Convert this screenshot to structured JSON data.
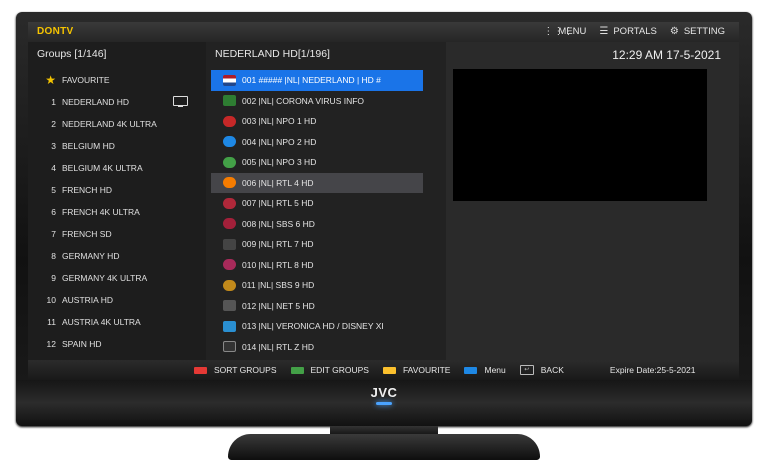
{
  "tv": {
    "brand": "JVC"
  },
  "app": {
    "logo": "DONTV"
  },
  "topmenu": {
    "menu": {
      "icon": "grid-icon",
      "label": "MENU"
    },
    "portals": {
      "icon": "portals-icon",
      "label": "PORTALS"
    },
    "setting": {
      "icon": "gear-icon",
      "label": "SETTING"
    }
  },
  "groups": {
    "title": "Groups [1/146]",
    "items": [
      {
        "num": "",
        "label": "FAVOURITE"
      },
      {
        "num": "1",
        "label": "NEDERLAND HD"
      },
      {
        "num": "2",
        "label": "NEDERLAND 4K ULTRA"
      },
      {
        "num": "3",
        "label": "BELGIUM HD"
      },
      {
        "num": "4",
        "label": "BELGIUM 4K ULTRA"
      },
      {
        "num": "5",
        "label": "FRENCH HD"
      },
      {
        "num": "6",
        "label": "FRENCH 4K ULTRA"
      },
      {
        "num": "7",
        "label": "FRENCH SD"
      },
      {
        "num": "8",
        "label": "GERMANY HD"
      },
      {
        "num": "9",
        "label": "GERMANY 4K ULTRA"
      },
      {
        "num": "10",
        "label": "AUSTRIA HD"
      },
      {
        "num": "11",
        "label": "AUSTRIA 4K ULTRA"
      },
      {
        "num": "12",
        "label": "SPAIN HD"
      }
    ]
  },
  "channels": {
    "title": "NEDERLAND HD[1/196]",
    "items": [
      {
        "text": "001  ##### |NL| NEDERLAND | HD #",
        "color": "#ae1c28",
        "logo": ""
      },
      {
        "text": "002  |NL| CORONA VIRUS INFO",
        "color": "#2e7d32",
        "logo": ""
      },
      {
        "text": "003  |NL| NPO 1 HD",
        "color": "#c62828",
        "logo": ""
      },
      {
        "text": "004  |NL| NPO 2 HD",
        "color": "#1e88e5",
        "logo": ""
      },
      {
        "text": "005  |NL| NPO 3 HD",
        "color": "#43a047",
        "logo": ""
      },
      {
        "text": "006  |NL| RTL 4 HD",
        "color": "#f57c00",
        "logo": ""
      },
      {
        "text": "007  |NL| RTL 5 HD",
        "color": "#b0283a",
        "logo": ""
      },
      {
        "text": "008  |NL| SBS 6 HD",
        "color": "#a3203a",
        "logo": ""
      },
      {
        "text": "009  |NL| RTL 7 HD",
        "color": "#444444",
        "logo": ""
      },
      {
        "text": "010  |NL| RTL 8 HD",
        "color": "#a82a5a",
        "logo": ""
      },
      {
        "text": "011  |NL| SBS 9 HD",
        "color": "#c28a1b",
        "logo": ""
      },
      {
        "text": "012  |NL| NET 5 HD",
        "color": "#555555",
        "logo": ""
      },
      {
        "text": "013  |NL| VERONICA HD / DISNEY XI",
        "color": "#2a8fd1",
        "logo": ""
      },
      {
        "text": "014  |NL| RTL Z HD",
        "color": "#333333",
        "logo": ""
      }
    ]
  },
  "status": {
    "clock": "12:29 AM 17-5-2021"
  },
  "bottombar": {
    "sort": {
      "label": "SORT GROUPS",
      "color": "#e53935"
    },
    "edit": {
      "label": "EDIT GROUPS",
      "color": "#43a047"
    },
    "fav": {
      "label": "FAVOURITE",
      "color": "#fbc02d"
    },
    "menu": {
      "label": "Menu",
      "color": "#1e88e5"
    },
    "back": {
      "label": "BACK",
      "icon": "back-key-icon"
    },
    "expire": "Expire Date:25-5-2021"
  },
  "colors": {
    "accent": "#1a74e8",
    "logo": "#f6c400"
  }
}
